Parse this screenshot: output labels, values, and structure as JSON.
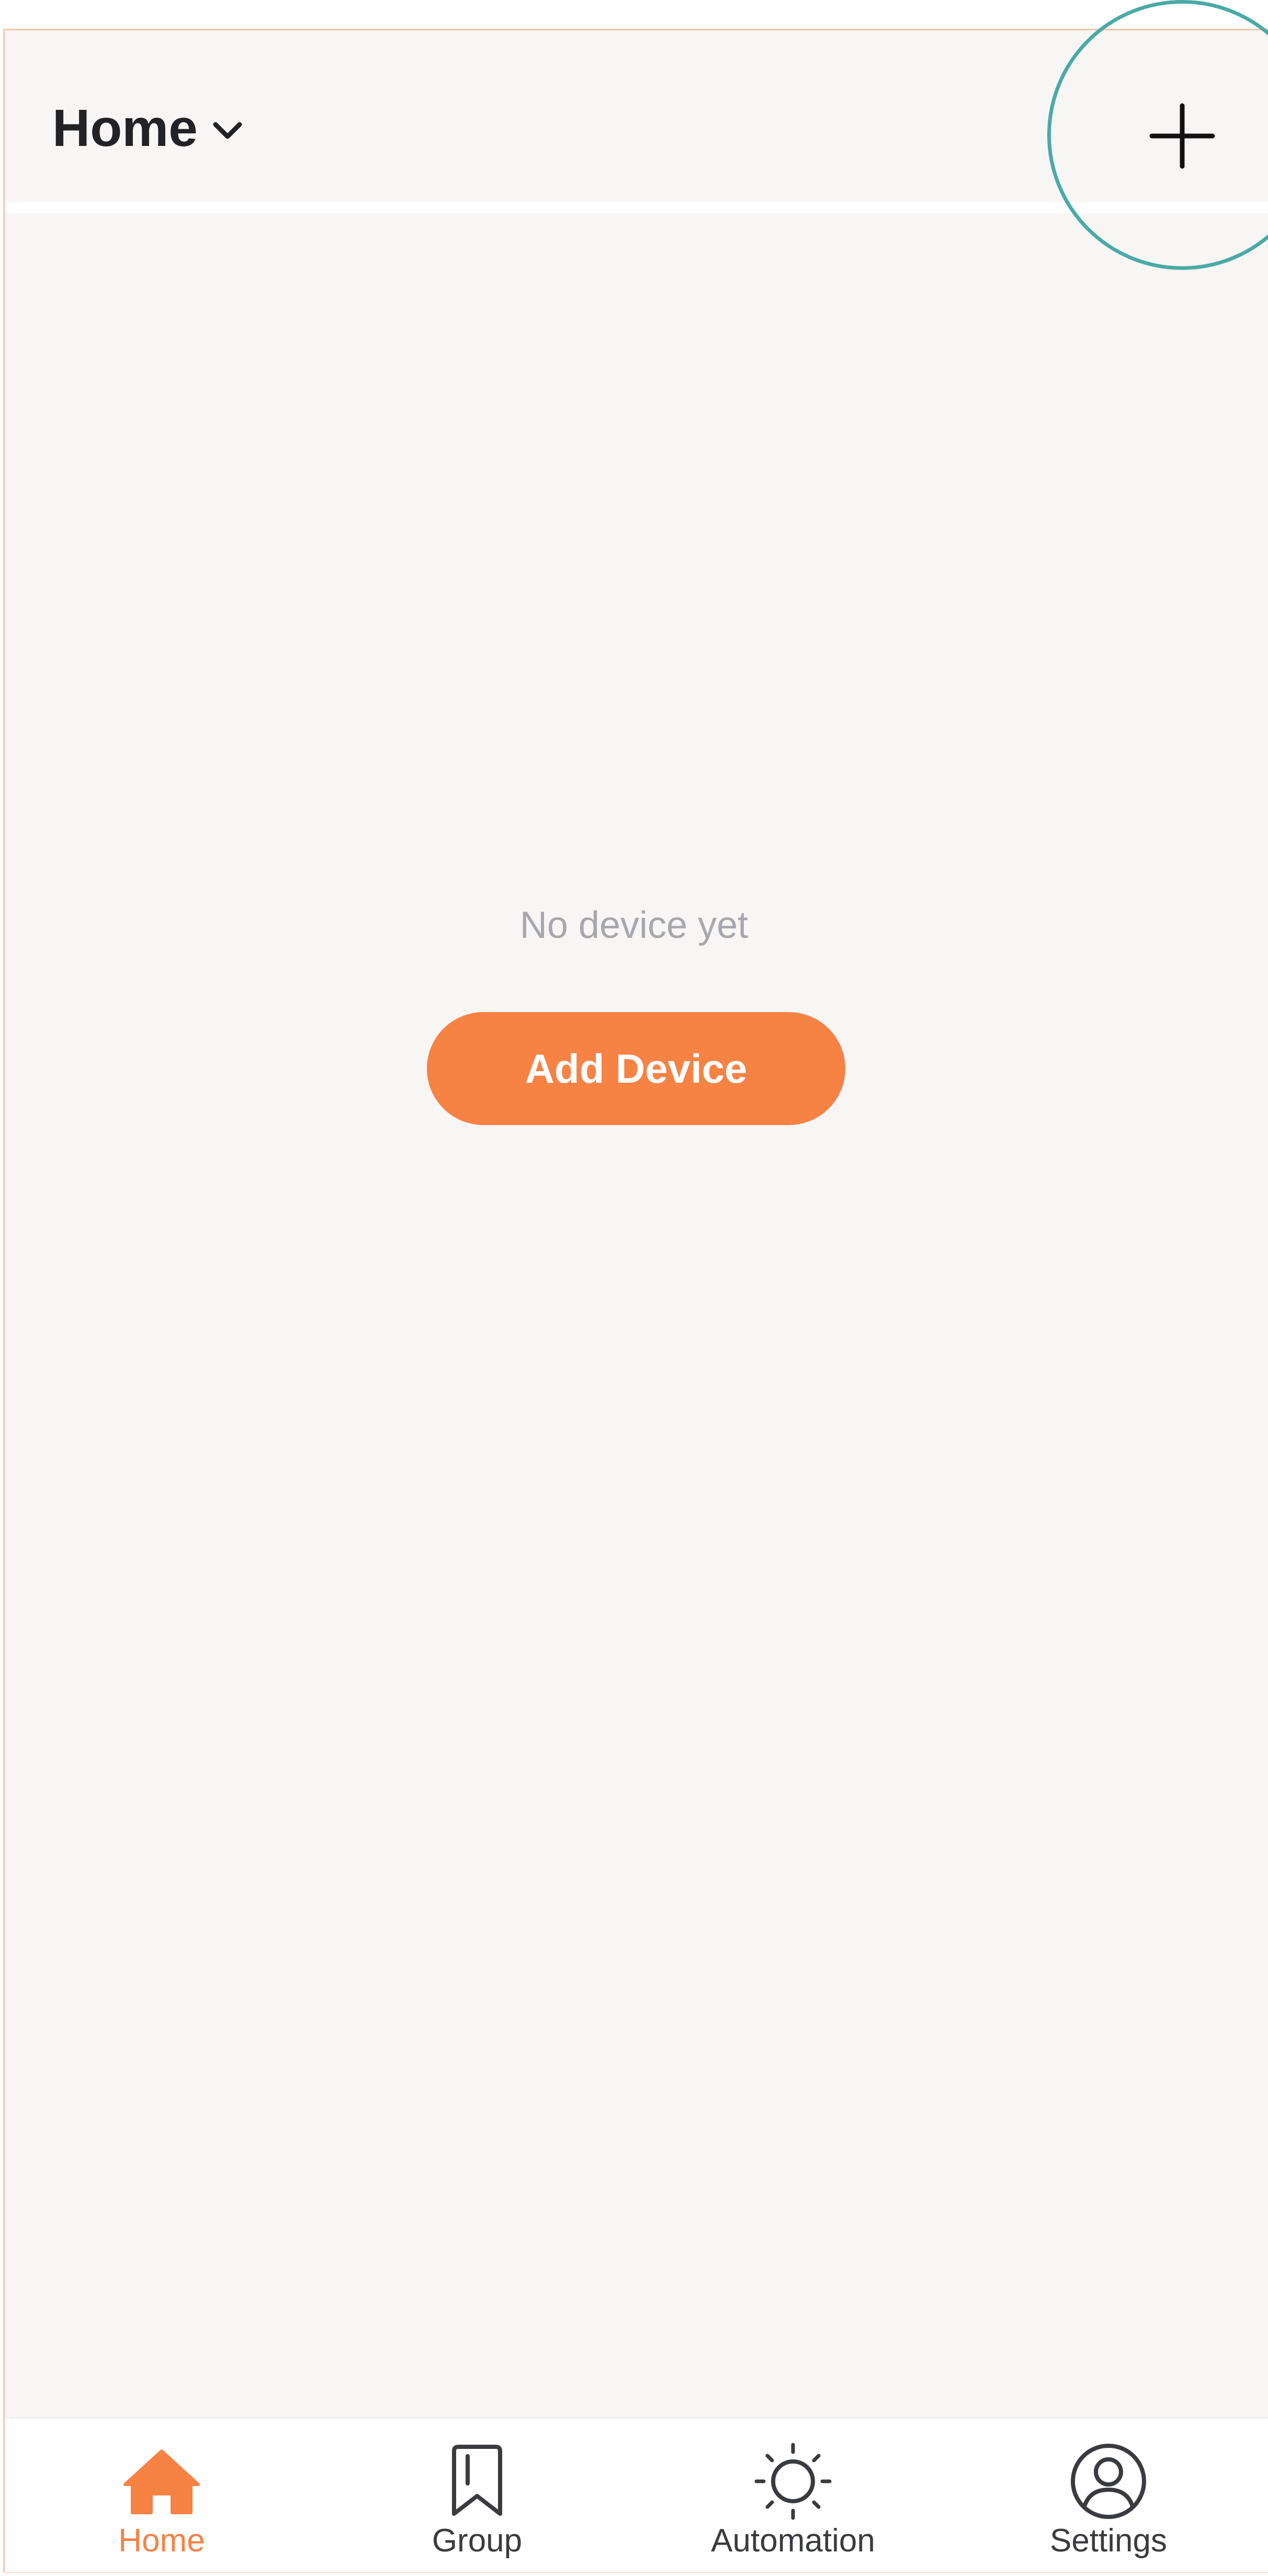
{
  "header": {
    "home_title": "Home",
    "add_icon": "plus-icon",
    "dropdown_icon": "chevron-down-icon"
  },
  "main": {
    "empty_message": "No device yet",
    "add_device_label": "Add Device"
  },
  "tabbar": {
    "items": [
      {
        "label": "Home",
        "icon": "home-icon",
        "active": true
      },
      {
        "label": "Group",
        "icon": "bookmark-icon",
        "active": false
      },
      {
        "label": "Automation",
        "icon": "sun-icon",
        "active": false
      },
      {
        "label": "Settings",
        "icon": "user-circle-icon",
        "active": false
      }
    ]
  },
  "colors": {
    "accent": "#f68244",
    "highlight_ring": "#49aaa6",
    "background": "#f8f5f5",
    "text_dark": "#222326",
    "text_muted": "#a7a8ad"
  }
}
